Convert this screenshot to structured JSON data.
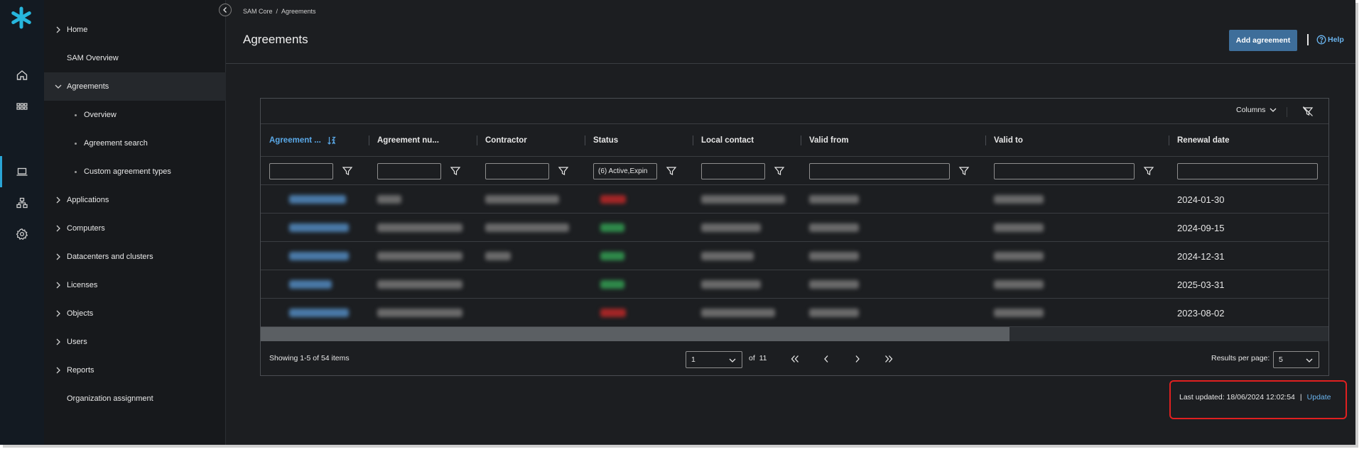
{
  "breadcrumb": {
    "root": "SAM Core",
    "separator": "/",
    "current": "Agreements"
  },
  "page": {
    "title": "Agreements"
  },
  "actions": {
    "add_label": "Add agreement",
    "help_label": "Help"
  },
  "nav": {
    "items": [
      {
        "label": "Home",
        "has_chevron": true,
        "expanded": false
      },
      {
        "label": "SAM Overview",
        "has_chevron": false
      },
      {
        "label": "Agreements",
        "has_chevron": true,
        "expanded": true,
        "active": true
      },
      {
        "label": "Overview",
        "sub": true
      },
      {
        "label": "Agreement search",
        "sub": true
      },
      {
        "label": "Custom agreement types",
        "sub": true
      },
      {
        "label": "Applications",
        "has_chevron": true,
        "expanded": false
      },
      {
        "label": "Computers",
        "has_chevron": true,
        "expanded": false
      },
      {
        "label": "Datacenters and clusters",
        "has_chevron": true,
        "expanded": false
      },
      {
        "label": "Licenses",
        "has_chevron": true,
        "expanded": false
      },
      {
        "label": "Objects",
        "has_chevron": true,
        "expanded": false
      },
      {
        "label": "Users",
        "has_chevron": true,
        "expanded": false
      },
      {
        "label": "Reports",
        "has_chevron": true,
        "expanded": false
      },
      {
        "label": "Organization assignment",
        "has_chevron": false
      }
    ]
  },
  "rail": {
    "icons": [
      "logo-asterisk-icon",
      "home-icon",
      "apps-grid-icon",
      "laptop-icon",
      "hierarchy-icon",
      "gear-icon"
    ],
    "active": "laptop-icon"
  },
  "grid": {
    "toolbar": {
      "columns_label": "Columns"
    },
    "columns": [
      {
        "label": "Agreement ...",
        "sorted": true
      },
      {
        "label": "Agreement nu..."
      },
      {
        "label": "Contractor"
      },
      {
        "label": "Status"
      },
      {
        "label": "Local contact"
      },
      {
        "label": "Valid from"
      },
      {
        "label": "Valid to"
      },
      {
        "label": "Renewal date"
      }
    ],
    "filters": {
      "status_value": "(6) Active,Expin"
    },
    "rows": [
      {
        "renewal_date": "2024-01-30",
        "status": "expired"
      },
      {
        "renewal_date": "2024-09-15",
        "status": "active"
      },
      {
        "renewal_date": "2024-12-31",
        "status": "active"
      },
      {
        "renewal_date": "2025-03-31",
        "status": "active"
      },
      {
        "renewal_date": "2023-08-02",
        "status": "expired"
      }
    ],
    "footer": {
      "showing": "Showing 1-5 of 54 items",
      "page_value": "1",
      "of_label": "of",
      "page_total": "11",
      "results_per_page_label": "Results per page:",
      "results_per_page_value": "5"
    },
    "scroll_fraction": 0.7
  },
  "status": {
    "last_updated": "Last updated: 18/06/2024 12:02:54",
    "separator": "|",
    "update_label": "Update"
  },
  "colors": {
    "accent": "#2aa5d6",
    "primary_button": "#3e6e9a",
    "link": "#6ab4ee",
    "sorted_header": "#5aa9e8",
    "highlight_border": "#e02020",
    "status_active": "#2f8a4a",
    "status_expired": "#a32626"
  }
}
